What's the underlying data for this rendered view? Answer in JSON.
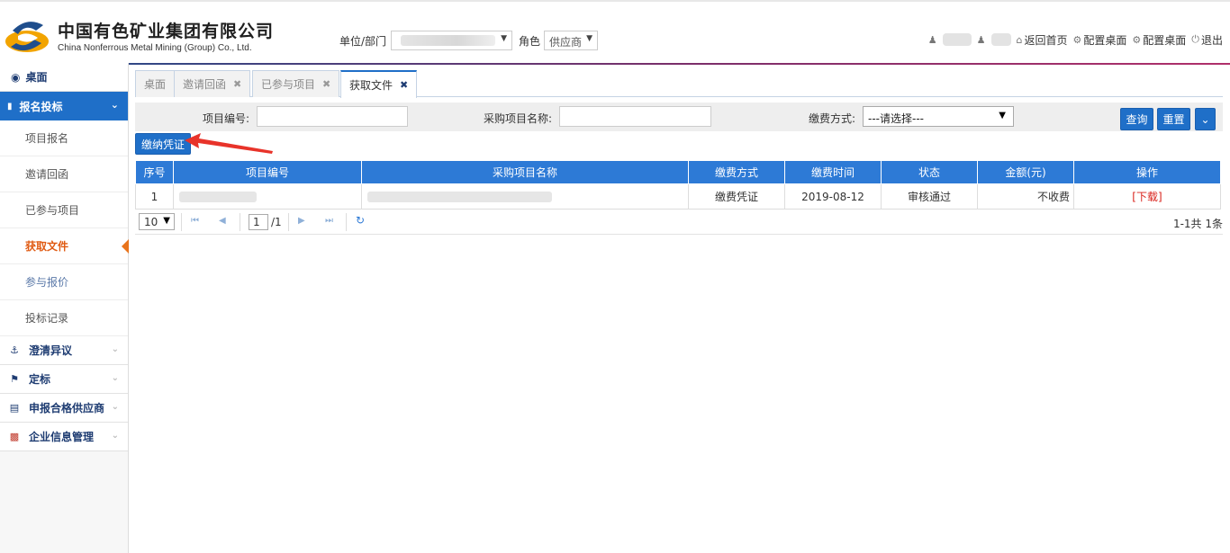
{
  "header": {
    "company_cn": "中国有色矿业集团有限公司",
    "company_en": "China Nonferrous Metal Mining (Group) Co., Ltd.",
    "unit_label": "单位/部门",
    "role_label": "角色",
    "role_value": "供应商",
    "links": {
      "home": "返回首页",
      "config1": "配置桌面",
      "config2": "配置桌面",
      "logout": "退出"
    }
  },
  "sidebar": {
    "desktop": "桌面",
    "active_group": "报名投标",
    "sub_items": [
      "项目报名",
      "邀请回函",
      "已参与项目",
      "获取文件",
      "参与报价",
      "投标记录"
    ],
    "groups": [
      "澄清异议",
      "定标",
      "申报合格供应商",
      "企业信息管理"
    ]
  },
  "tabs": [
    {
      "label": "桌面",
      "closable": false
    },
    {
      "label": "邀请回函",
      "closable": true
    },
    {
      "label": "已参与项目",
      "closable": true
    },
    {
      "label": "获取文件",
      "closable": true,
      "active": true
    }
  ],
  "search": {
    "project_no_label": "项目编号:",
    "project_name_label": "采购项目名称:",
    "pay_method_label": "缴费方式:",
    "pay_method_value": "---请选择---",
    "query_button": "查询",
    "reset_button": "重置"
  },
  "toolbar": {
    "pay_voucher_button": "缴纳凭证"
  },
  "table": {
    "columns": [
      "序号",
      "项目编号",
      "采购项目名称",
      "缴费方式",
      "缴费时间",
      "状态",
      "金额(元)",
      "操作"
    ],
    "rows": [
      {
        "index": "1",
        "pay_method": "缴费凭证",
        "pay_time": "2019-08-12",
        "status": "审核通过",
        "amount": "不收费",
        "action": "下载"
      }
    ]
  },
  "pager": {
    "page_size": "10",
    "page": "1",
    "total_pages": "/1",
    "summary": "1-1共 1条"
  },
  "colors": {
    "primary": "#1f6fc8",
    "active_menu": "#e05a12",
    "download": "#d9231c"
  }
}
